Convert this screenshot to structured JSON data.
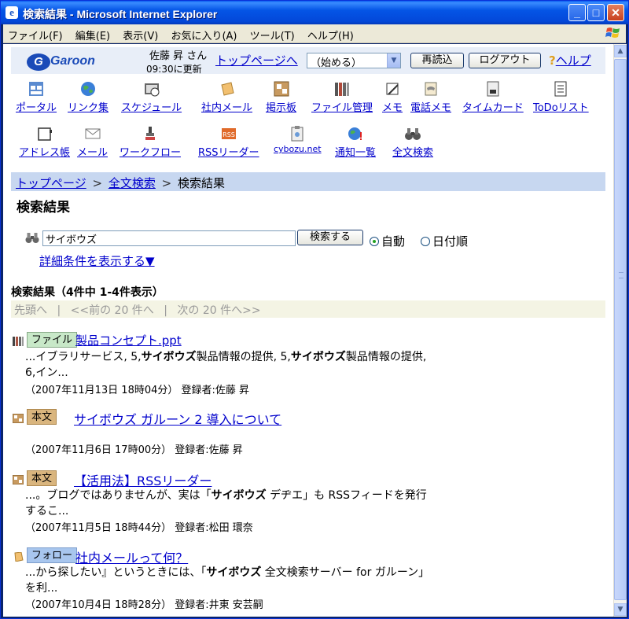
{
  "window": {
    "title": "検索結果 - Microsoft Internet Explorer",
    "min_glyph": "_",
    "max_glyph": "□",
    "close_glyph": "✕"
  },
  "menubar": [
    "ファイル(F)",
    "編集(E)",
    "表示(V)",
    "お気に入り(A)",
    "ツール(T)",
    "ヘルプ(H)"
  ],
  "header": {
    "logo_text": "Garoon",
    "user_name": "佐藤 昇 さん",
    "updated": "09:30に更新",
    "top_link": "トップページへ",
    "select_value": "（始める）",
    "reload_label": "再読込",
    "logout_label": "ログアウト",
    "help_mark": "?",
    "help_label": "ヘルプ"
  },
  "apps_row1": [
    "ポータル",
    "リンク集",
    "スケジュール",
    "社内メール",
    "掲示板",
    "ファイル管理",
    "メモ",
    "電話メモ",
    "タイムカード",
    "ToDoリスト"
  ],
  "apps_row2": [
    "アドレス帳",
    "メール",
    "ワークフロー",
    "RSSリーダー",
    "cybozu.net",
    "通知一覧",
    "全文検索"
  ],
  "breadcrumb": {
    "top": "トップページ",
    "search": "全文検索",
    "current": "検索結果",
    "sep": ">"
  },
  "page_title": "検索結果",
  "search": {
    "query": "サイボウズ",
    "button": "検索する",
    "radio_auto": "自動",
    "radio_date": "日付順",
    "detail_link": "詳細条件を表示する▼"
  },
  "results_summary": "検索結果（4件中 1-4件表示）",
  "pager": {
    "first": "先頭へ",
    "sep": "|",
    "prev": "<<前の 20 件へ",
    "next": "次の 20 件へ>>"
  },
  "results": [
    {
      "badge": "ファイル",
      "title": "製品コンセプト.ppt",
      "snippet_parts": [
        "...イブラリサービス, 5,",
        "サイボウズ",
        "製品情報の提供, 5,",
        "サイボウズ",
        "製品情報の提供, 6,イン..."
      ],
      "meta": "（2007年11月13日 18時04分） 登録者:佐藤 昇"
    },
    {
      "badge": "本文",
      "title": "サイボウズ ガルーン 2 導入について",
      "snippet_parts": [],
      "meta": "（2007年11月6日 17時00分） 登録者:佐藤 昇"
    },
    {
      "badge": "本文",
      "title": "【活用法】RSSリーダー",
      "snippet_parts": [
        "...。ブログではありませんが、実は「",
        "サイボウズ",
        " デヂエ」も RSSフィードを発行するこ..."
      ],
      "meta": "（2007年11月5日 18時44分） 登録者:松田 環奈"
    },
    {
      "badge": "フォロー",
      "title": "社内メールって何？",
      "snippet_parts": [
        "...から探したい』というときには、「",
        "サイボウズ",
        " 全文検索サーバー for ガルーン」を利..."
      ],
      "meta": "（2007年10月4日 18時28分） 登録者:井東 安芸嗣"
    }
  ]
}
